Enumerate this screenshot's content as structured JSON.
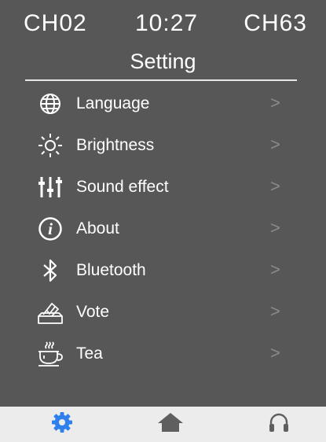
{
  "status": {
    "left_channel": "CH02",
    "time": "10:27",
    "right_channel": "CH63"
  },
  "title": "Setting",
  "menu": [
    {
      "label": "Language",
      "icon": "globe-icon",
      "chevron": ">"
    },
    {
      "label": "Brightness",
      "icon": "sun-icon",
      "chevron": ">"
    },
    {
      "label": "Sound effect",
      "icon": "equalizer-icon",
      "chevron": ">"
    },
    {
      "label": "About",
      "icon": "info-icon",
      "chevron": ">"
    },
    {
      "label": "Bluetooth",
      "icon": "bluetooth-icon",
      "chevron": ">"
    },
    {
      "label": "Vote",
      "icon": "ballot-icon",
      "chevron": ">"
    },
    {
      "label": "Tea",
      "icon": "tea-cup-icon",
      "chevron": ">"
    }
  ],
  "tabbar": {
    "tabs": [
      {
        "icon": "gear-icon",
        "active": true
      },
      {
        "icon": "home-icon",
        "active": false
      },
      {
        "icon": "headphones-icon",
        "active": false
      }
    ]
  },
  "colors": {
    "background": "#575757",
    "text": "#ffffff",
    "chevron": "#8a8a8a",
    "tabbar": "#ececec",
    "active_tab": "#2f80ed",
    "inactive_tab": "#5f5f5f"
  }
}
